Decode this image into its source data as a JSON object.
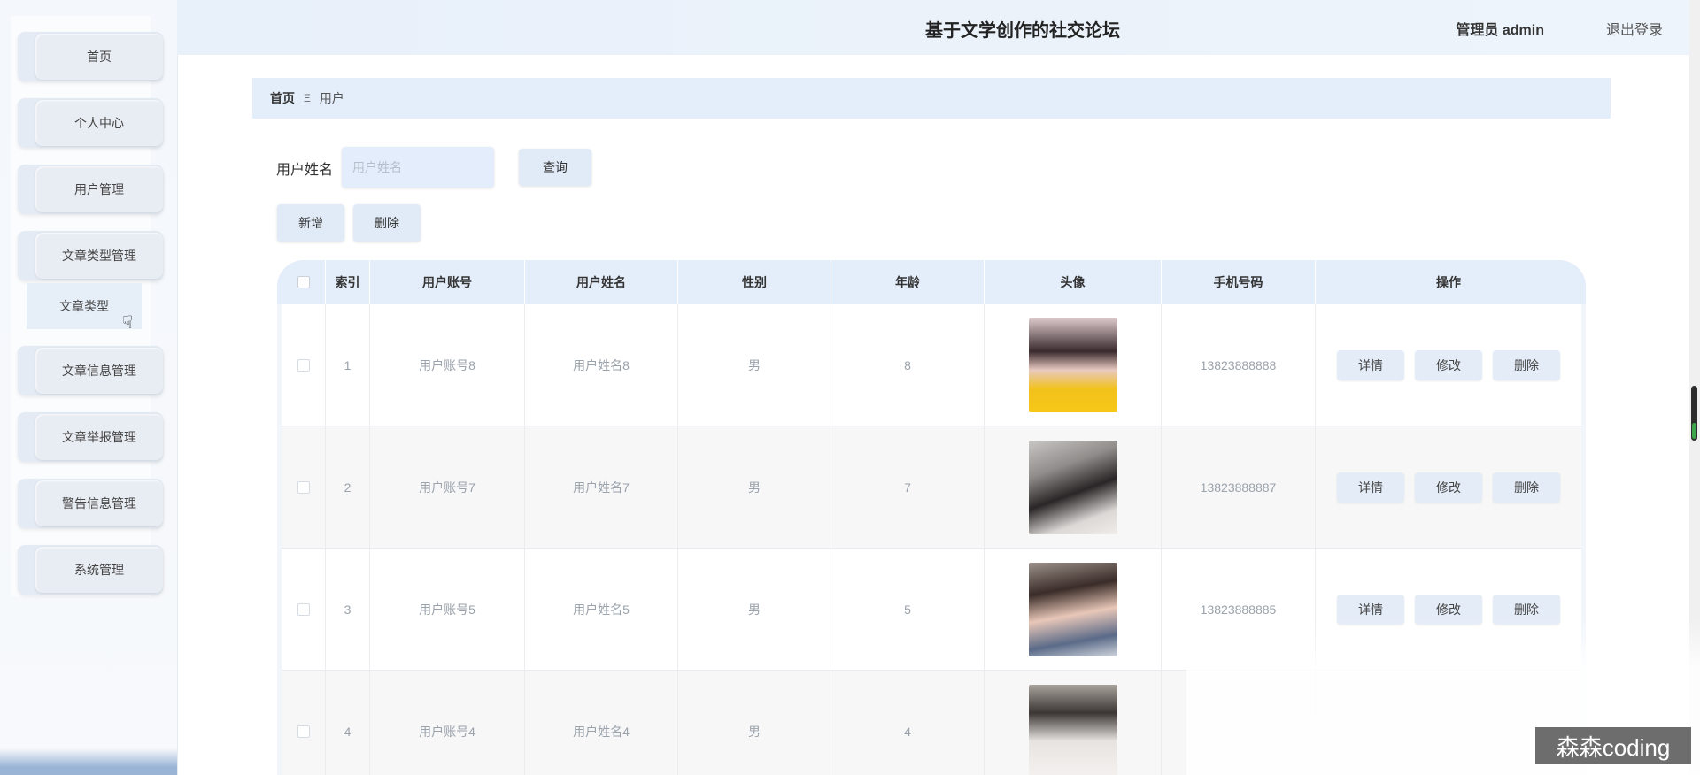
{
  "header": {
    "title": "基于文学创作的社交论坛",
    "user": "管理员 admin",
    "logout": "退出登录"
  },
  "sidebar": {
    "items": [
      {
        "label": "首页"
      },
      {
        "label": "个人中心"
      },
      {
        "label": "用户管理"
      },
      {
        "label": "文章类型管理"
      },
      {
        "label": "文章信息管理"
      },
      {
        "label": "文章举报管理"
      },
      {
        "label": "警告信息管理"
      },
      {
        "label": "系统管理"
      }
    ],
    "submenu_label": "文章类型"
  },
  "breadcrumb": {
    "home": "首页",
    "separator": "Ξ",
    "current": "用户"
  },
  "search": {
    "label": "用户姓名",
    "placeholder": "用户姓名",
    "value": "",
    "query_button": "查询"
  },
  "actions": {
    "add": "新增",
    "delete": "删除"
  },
  "table": {
    "columns": [
      "索引",
      "用户账号",
      "用户姓名",
      "性别",
      "年龄",
      "头像",
      "手机号码",
      "操作"
    ],
    "rows": [
      {
        "index": "1",
        "account": "用户账号8",
        "name": "用户姓名8",
        "gender": "男",
        "age": "8",
        "phone": "13823888888"
      },
      {
        "index": "2",
        "account": "用户账号7",
        "name": "用户姓名7",
        "gender": "男",
        "age": "7",
        "phone": "13823888887"
      },
      {
        "index": "3",
        "account": "用户账号5",
        "name": "用户姓名5",
        "gender": "男",
        "age": "5",
        "phone": "13823888885"
      },
      {
        "index": "4",
        "account": "用户账号4",
        "name": "用户姓名4",
        "gender": "男",
        "age": "4",
        "phone": ""
      }
    ],
    "op_labels": {
      "detail": "详情",
      "edit": "修改",
      "delete": "删除"
    }
  },
  "watermark": "森森coding"
}
